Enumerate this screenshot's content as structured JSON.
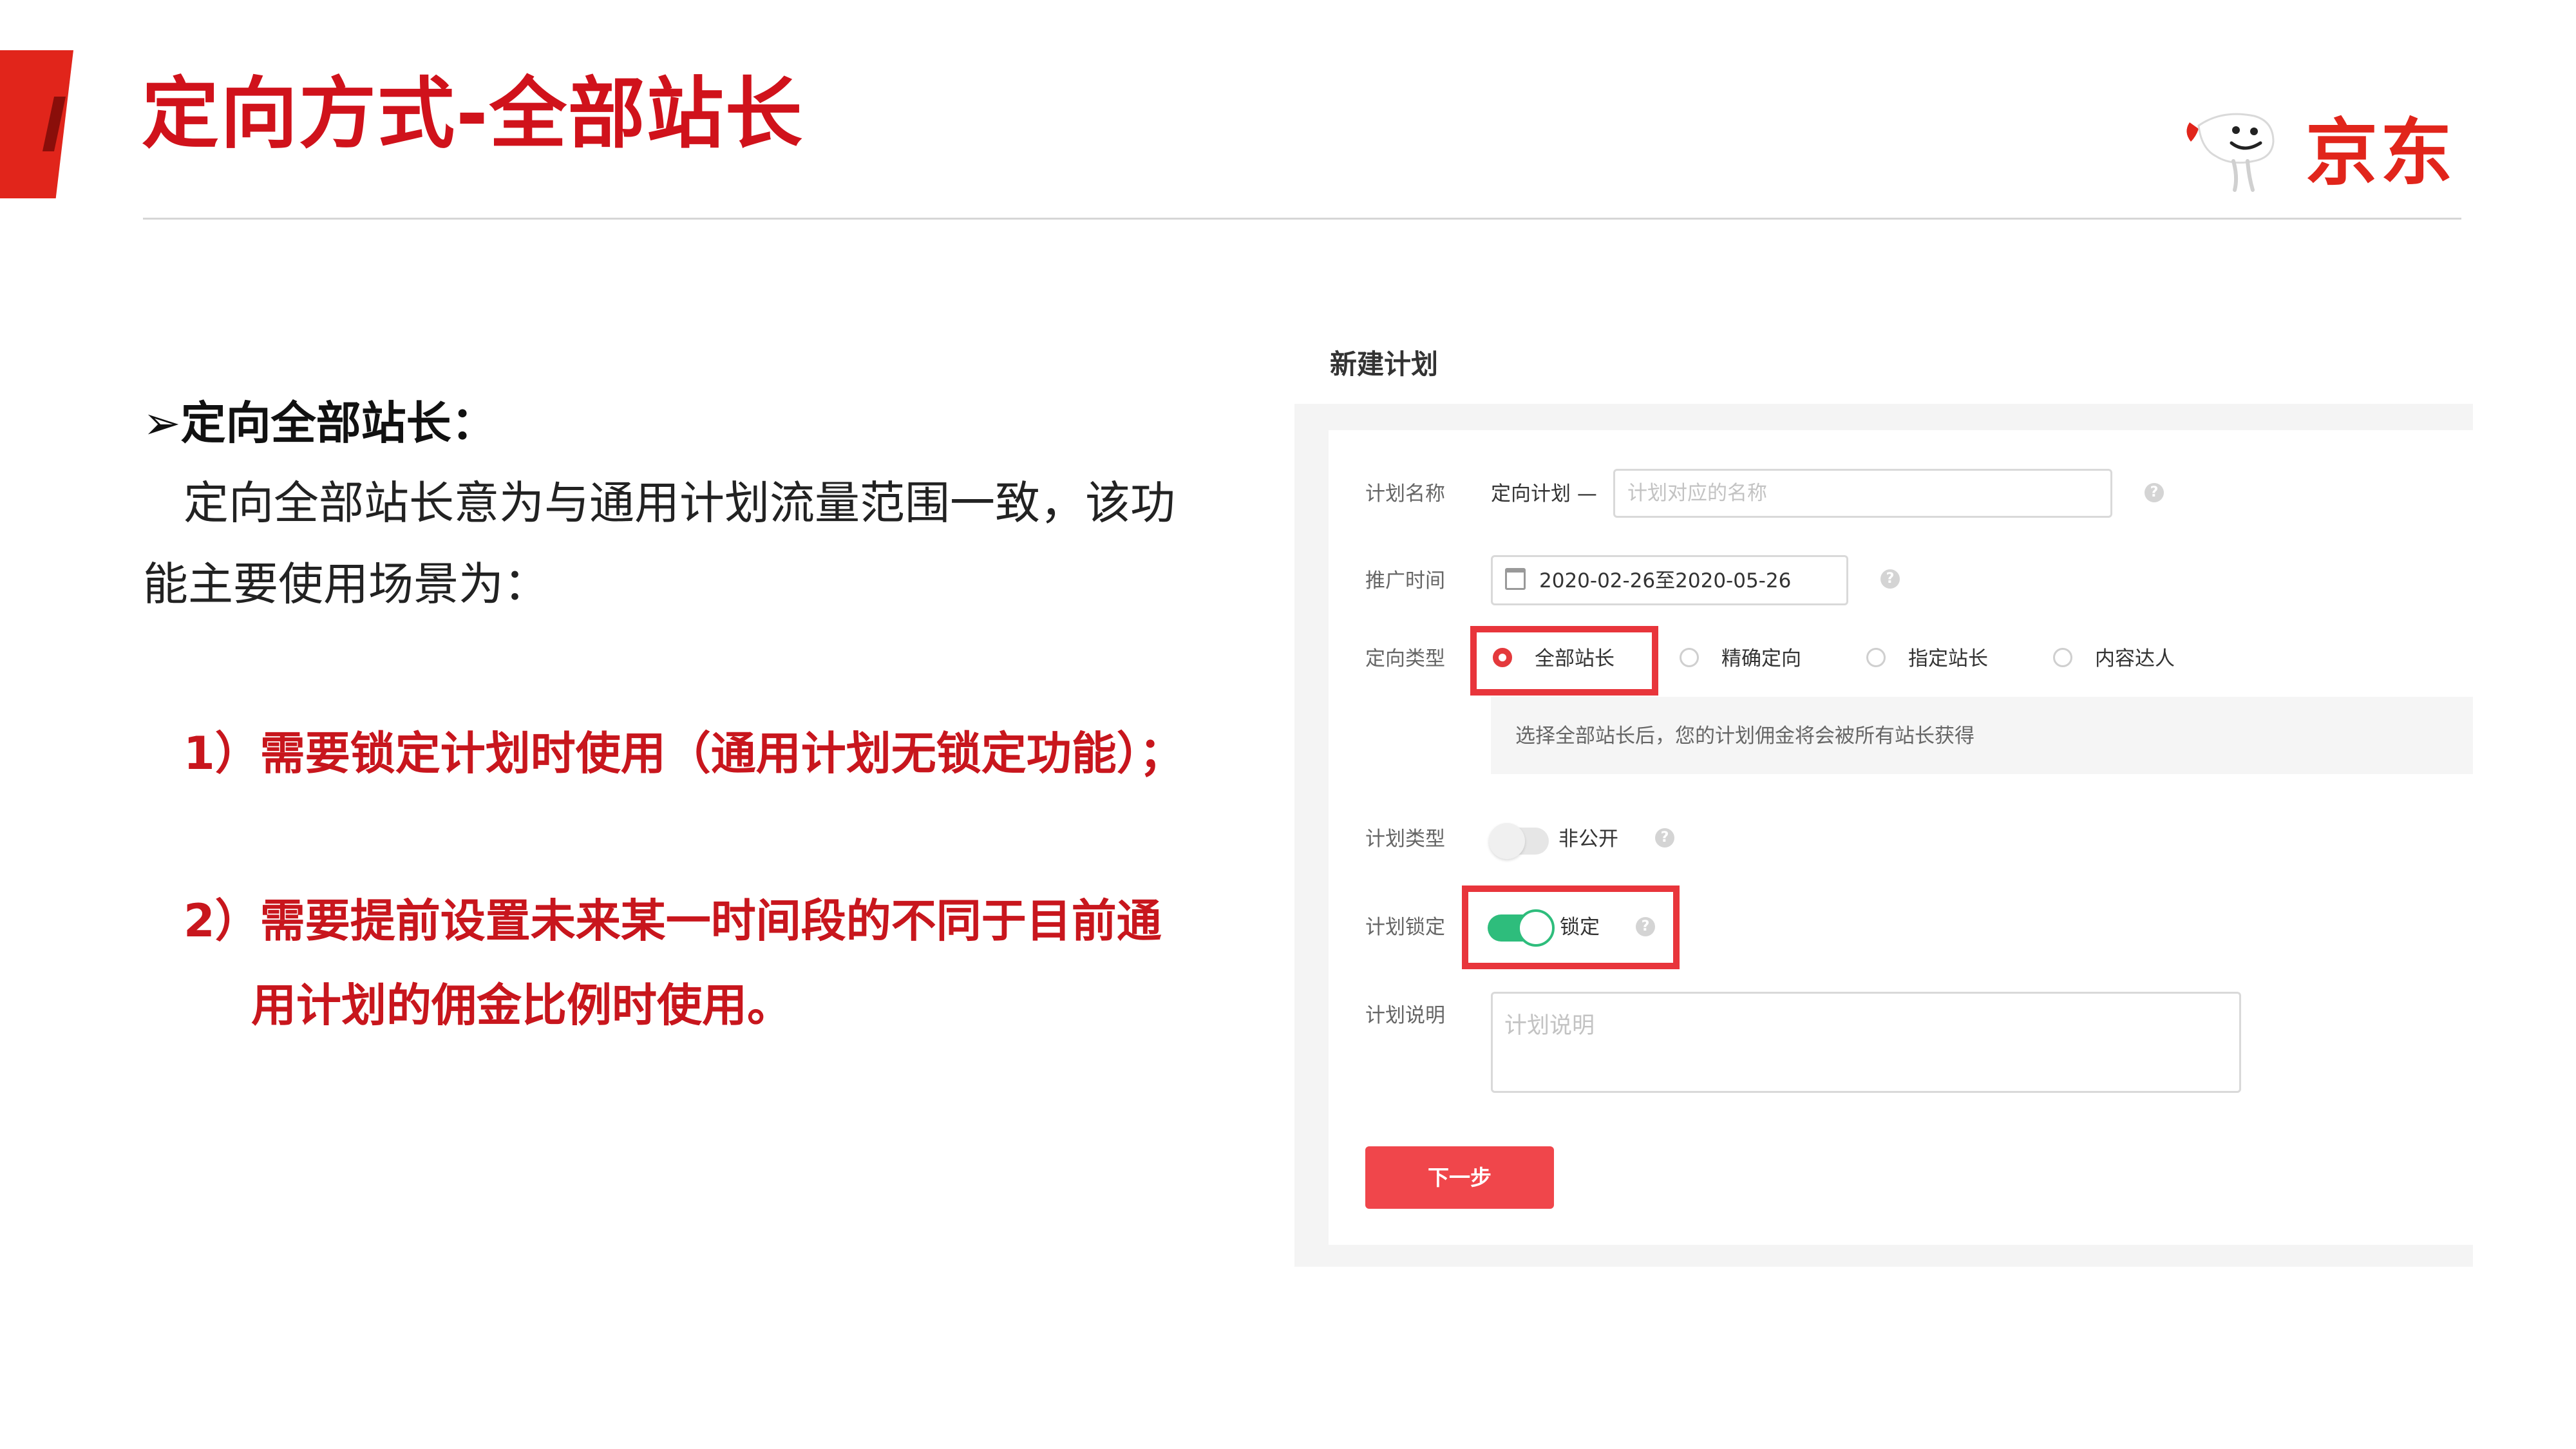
{
  "slide": {
    "title": "定向方式-全部站长",
    "logo_text": "京东",
    "accent_color": "#e1251b",
    "title_color": "#d0121b"
  },
  "intro": {
    "heading": "➢定向全部站长：",
    "line1": "定向全部站长意为与通用计划流量范围一致，该功",
    "line2": "能主要使用场景为："
  },
  "points": {
    "p1": "1）需要锁定计划时使用（通用计划无锁定功能）；",
    "p2_line1": "2）需要提前设置未来某一时间段的不同于目前通",
    "p2_line2": "用计划的佣金比例时使用。"
  },
  "form": {
    "title": "新建计划",
    "name_label": "计划名称",
    "name_prefix": "定向计划 —",
    "name_placeholder": "计划对应的名称",
    "time_label": "推广时间",
    "time_value": "2020-02-26至2020-05-26",
    "target_label": "定向类型",
    "target_options": [
      "全部站长",
      "精确定向",
      "指定站长",
      "内容达人"
    ],
    "target_selected": "全部站长",
    "notice": "选择全部站长后，您的计划佣金将会被所有站长获得",
    "plan_type_label": "计划类型",
    "plan_type_value": "非公开",
    "lock_label": "计划锁定",
    "lock_value": "锁定",
    "desc_label": "计划说明",
    "desc_placeholder": "计划说明",
    "next_button": "下一步",
    "help_glyph": "?",
    "icons": [
      "calendar-icon",
      "help-icon"
    ],
    "highlight_color": "#e8353b",
    "toggle_on_color": "#2ebd7c",
    "button_color": "#f0464b"
  }
}
